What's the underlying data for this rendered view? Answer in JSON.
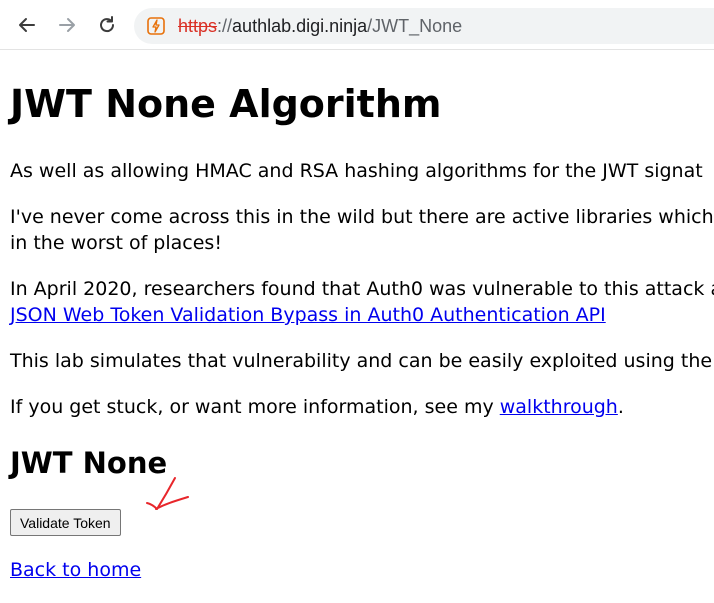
{
  "browser": {
    "url_scheme": "https",
    "url_separator": "://",
    "url_host": "authlab.digi.ninja",
    "url_path": "/JWT_None",
    "icons": {
      "back": "back-arrow-icon",
      "forward": "forward-arrow-icon",
      "reload": "reload-icon",
      "site": "not-secure-icon"
    }
  },
  "page": {
    "title": "JWT None Algorithm",
    "p1": "As well as allowing HMAC and RSA hashing algorithms for the JWT signat",
    "p2_line1": "I've never come across this in the wild but there are active libraries which",
    "p2_line2": "in the worst of places!",
    "p3_line1": "In April 2020, researchers found that Auth0 was vulnerable to this attack a",
    "p3_link": "JSON Web Token Validation Bypass in Auth0 Authentication API",
    "p4": "This lab simulates that vulnerability and can be easily exploited using the",
    "p5_text": "If you get stuck, or want more information, see my ",
    "p5_link": "walkthrough",
    "p5_end": ".",
    "subtitle": "JWT None",
    "validate_button": "Validate Token",
    "back_link": "Back to home"
  },
  "colors": {
    "link": "#0000ee",
    "annotation": "#e8262b",
    "insecure_scheme": "#d93025"
  }
}
